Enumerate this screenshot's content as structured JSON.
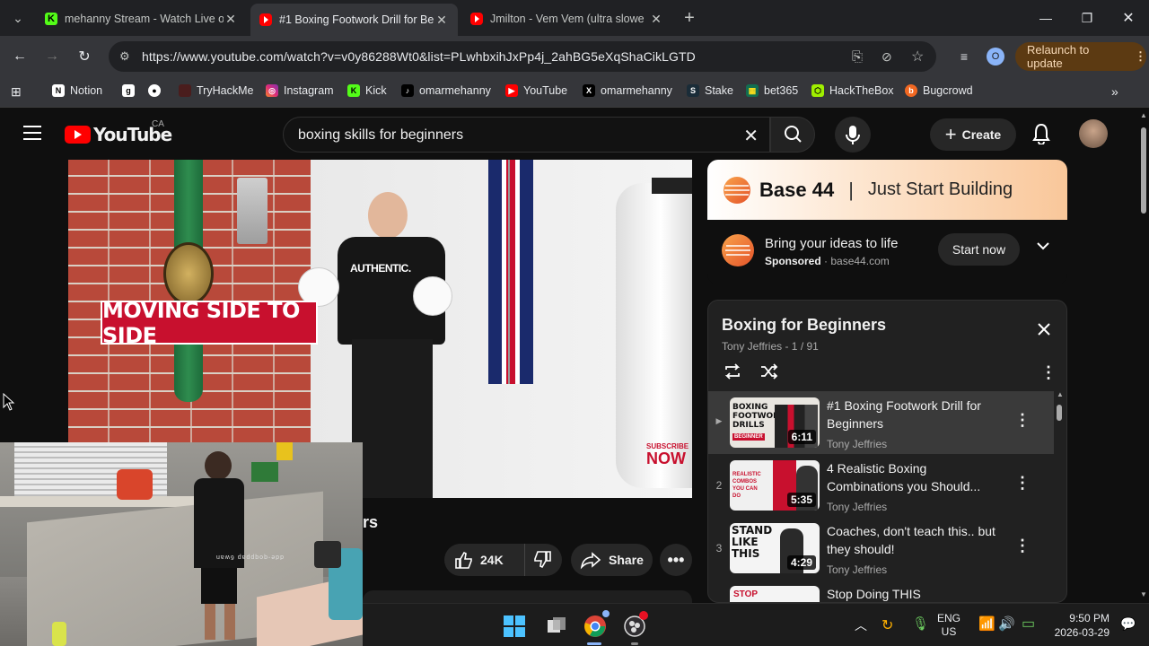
{
  "browser": {
    "tabs": [
      {
        "title": "mehanny Stream - Watch Live o",
        "favicon": "kick-icon"
      },
      {
        "title": "#1 Boxing Footwork Drill for Be",
        "favicon": "youtube-icon"
      },
      {
        "title": "Jmilton - Vem Vem (ultra slowe",
        "favicon": "youtube-icon"
      }
    ],
    "url": "https://www.youtube.com/watch?v=v0y86288Wt0&list=PLwhbxihJxPp4j_2ahBG5eXqShaCikLGTD",
    "profile_initial": "O",
    "relaunch_label": "Relaunch to update",
    "bookmarks": [
      "Notion",
      "TryHackMe",
      "Instagram",
      "Kick",
      "omarmehanny",
      "YouTube",
      "omarmehanny",
      "Stake",
      "bet365",
      "HackTheBox",
      "Bugcrowd"
    ]
  },
  "youtube": {
    "logo_text": "YouTube",
    "country": "CA",
    "search_query": "boxing skills for beginners",
    "create_label": "Create",
    "video": {
      "overlay_text": "MOVING SIDE TO SIDE",
      "shirt_text": "AUTHENTIC.",
      "subscribe_text": "SUBSCRIBE",
      "now_text": "NOW",
      "title_fragment": "rs",
      "likes": "24K",
      "share_label": "Share"
    },
    "ad": {
      "brand": "Base 44",
      "tagline": "Just Start Building",
      "headline": "Bring your ideas to life",
      "sponsored": "Sponsored",
      "domain": "base44.com",
      "cta": "Start now"
    },
    "playlist": {
      "title": "Boxing for Beginners",
      "meta": "Tony Jeffries - 1 / 91",
      "items": [
        {
          "index": "▶",
          "title": "#1 Boxing Footwork Drill for Beginners",
          "channel": "Tony Jeffries",
          "duration": "6:11",
          "thumb_text": "BOXING FOOTWORK DRILLS",
          "thumb_tag": "BEGINNER"
        },
        {
          "index": "2",
          "title": "4 Realistic Boxing Combinations you Should...",
          "channel": "Tony Jeffries",
          "duration": "5:35",
          "thumb_text": "REALISTIC COMBOS YOU CAN DO"
        },
        {
          "index": "3",
          "title": "Coaches, don't teach this.. but they should!",
          "channel": "Tony Jeffries",
          "duration": "4:29",
          "thumb_text": "STAND LIKE THIS"
        },
        {
          "index": "",
          "title": "Stop Doing THIS",
          "channel": "",
          "duration": "",
          "thumb_text": "STOP"
        }
      ]
    }
  },
  "webcam": {
    "caption": "dde-qoqppap 6wan"
  },
  "taskbar": {
    "lang_top": "ENG",
    "lang_bottom": "US",
    "time": "9:50 PM",
    "date": "2026-03-29"
  }
}
